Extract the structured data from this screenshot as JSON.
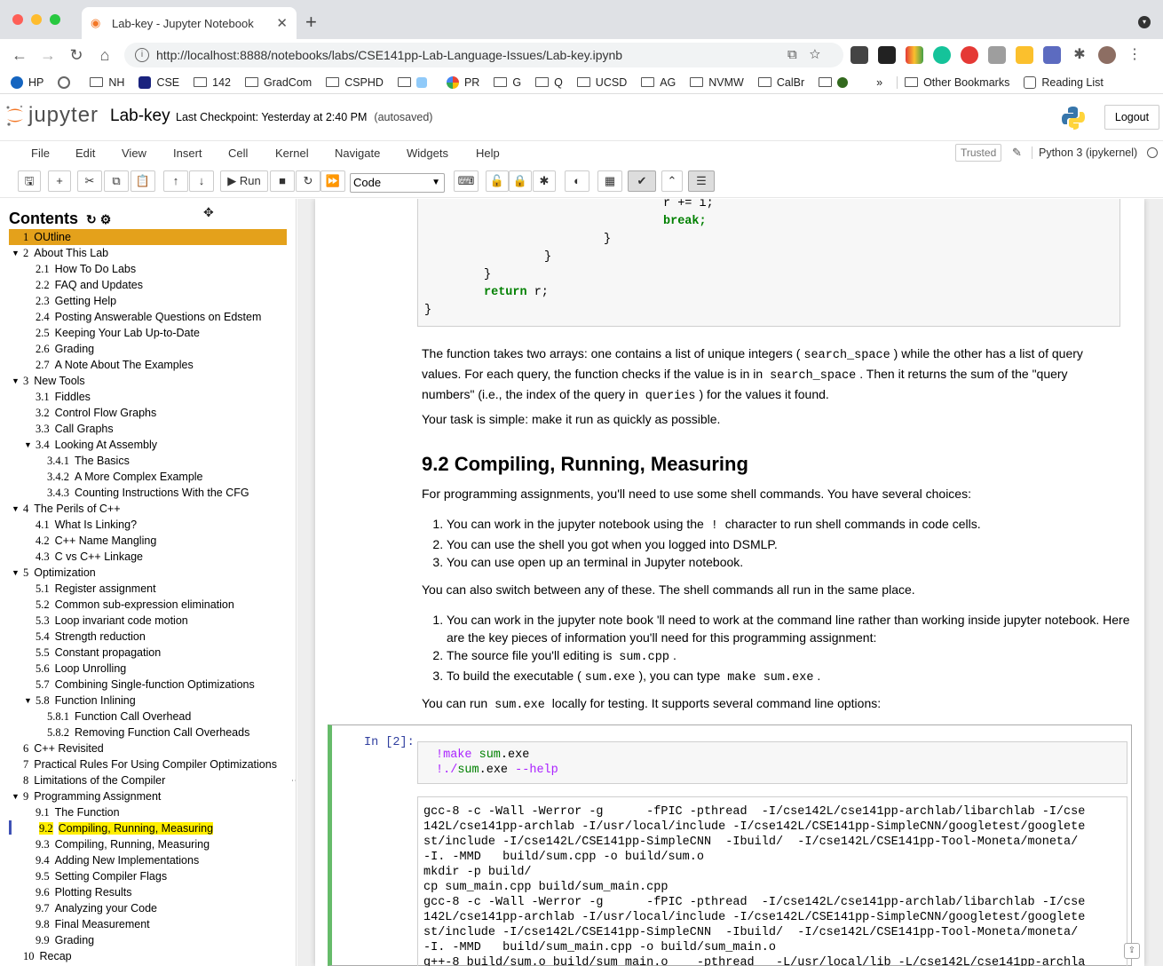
{
  "browser": {
    "tab_title": "Lab-key - Jupyter Notebook",
    "url": "http://localhost:8888/notebooks/labs/CSE141pp-Lab-Language-Issues/Lab-key.ipynb",
    "bookmarks": [
      "HP",
      "NH",
      "CSE",
      "142",
      "GradCom",
      "CSPHD",
      "PR",
      "G",
      "Q",
      "UCSD",
      "AG",
      "NVMW",
      "CalBr"
    ],
    "more": "»",
    "other_bookmarks": "Other Bookmarks",
    "reading_list": "Reading List"
  },
  "jupyter": {
    "logo_text": "jupyter",
    "notebook_name": "Lab-key",
    "checkpoint": "Last Checkpoint: Yesterday at 2:40 PM",
    "autosave": "(autosaved)",
    "logout": "Logout",
    "menu": [
      "File",
      "Edit",
      "View",
      "Insert",
      "Cell",
      "Kernel",
      "Navigate",
      "Widgets",
      "Help"
    ],
    "trusted": "Trusted",
    "kernel": "Python 3 (ipykernel)",
    "run_label": "Run",
    "cell_type": "Code"
  },
  "toc": {
    "title": "Contents",
    "items": [
      {
        "n": "1",
        "t": "OUtline",
        "lvl": 0,
        "hl": 1
      },
      {
        "n": "2",
        "t": "About This Lab",
        "lvl": 0,
        "tri": true
      },
      {
        "n": "2.1",
        "t": "How To Do Labs",
        "lvl": 1
      },
      {
        "n": "2.2",
        "t": "FAQ and Updates",
        "lvl": 1
      },
      {
        "n": "2.3",
        "t": "Getting Help",
        "lvl": 1
      },
      {
        "n": "2.4",
        "t": "Posting Answerable Questions on Edstem",
        "lvl": 1
      },
      {
        "n": "2.5",
        "t": "Keeping Your Lab Up-to-Date",
        "lvl": 1
      },
      {
        "n": "2.6",
        "t": "Grading",
        "lvl": 1
      },
      {
        "n": "2.7",
        "t": "A Note About The Examples",
        "lvl": 1
      },
      {
        "n": "3",
        "t": "New Tools",
        "lvl": 0,
        "tri": true
      },
      {
        "n": "3.1",
        "t": "Fiddles",
        "lvl": 1
      },
      {
        "n": "3.2",
        "t": "Control Flow Graphs",
        "lvl": 1
      },
      {
        "n": "3.3",
        "t": "Call Graphs",
        "lvl": 1
      },
      {
        "n": "3.4",
        "t": "Looking At Assembly",
        "lvl": 1,
        "tri": true
      },
      {
        "n": "3.4.1",
        "t": "The Basics",
        "lvl": 2
      },
      {
        "n": "3.4.2",
        "t": "A More Complex Example",
        "lvl": 2
      },
      {
        "n": "3.4.3",
        "t": "Counting Instructions With the CFG",
        "lvl": 2
      },
      {
        "n": "4",
        "t": "The Perils of C++",
        "lvl": 0,
        "tri": true
      },
      {
        "n": "4.1",
        "t": "What Is Linking?",
        "lvl": 1
      },
      {
        "n": "4.2",
        "t": "C++ Name Mangling",
        "lvl": 1
      },
      {
        "n": "4.3",
        "t": "C vs C++ Linkage",
        "lvl": 1
      },
      {
        "n": "5",
        "t": "Optimization",
        "lvl": 0,
        "tri": true
      },
      {
        "n": "5.1",
        "t": "Register assignment",
        "lvl": 1
      },
      {
        "n": "5.2",
        "t": "Common sub-expression elimination",
        "lvl": 1
      },
      {
        "n": "5.3",
        "t": "Loop invariant code motion",
        "lvl": 1
      },
      {
        "n": "5.4",
        "t": "Strength reduction",
        "lvl": 1
      },
      {
        "n": "5.5",
        "t": "Constant propagation",
        "lvl": 1
      },
      {
        "n": "5.6",
        "t": "Loop Unrolling",
        "lvl": 1
      },
      {
        "n": "5.7",
        "t": "Combining Single-function Optimizations",
        "lvl": 1
      },
      {
        "n": "5.8",
        "t": "Function Inlining",
        "lvl": 1,
        "tri": true
      },
      {
        "n": "5.8.1",
        "t": "Function Call Overhead",
        "lvl": 2
      },
      {
        "n": "5.8.2",
        "t": "Removing Function Call Overheads",
        "lvl": 2
      },
      {
        "n": "6",
        "t": "C++ Revisited",
        "lvl": 0
      },
      {
        "n": "7",
        "t": "Practical Rules For Using Compiler Optimizations",
        "lvl": 0
      },
      {
        "n": "8",
        "t": "Limitations of the Compiler",
        "lvl": 0
      },
      {
        "n": "9",
        "t": "Programming Assignment",
        "lvl": 0,
        "tri": true
      },
      {
        "n": "9.1",
        "t": "The Function",
        "lvl": 1
      },
      {
        "n": "9.2",
        "t": "Compiling, Running, Measuring",
        "lvl": 1,
        "hl": 2
      },
      {
        "n": "9.3",
        "t": "Compiling, Running, Measuring",
        "lvl": 1
      },
      {
        "n": "9.4",
        "t": "Adding New Implementations",
        "lvl": 1
      },
      {
        "n": "9.5",
        "t": "Setting Compiler Flags",
        "lvl": 1
      },
      {
        "n": "9.6",
        "t": "Plotting Results",
        "lvl": 1
      },
      {
        "n": "9.7",
        "t": "Analyzing your Code",
        "lvl": 1
      },
      {
        "n": "9.8",
        "t": "Final Measurement",
        "lvl": 1
      },
      {
        "n": "9.9",
        "t": "Grading",
        "lvl": 1
      },
      {
        "n": "10",
        "t": "Recap",
        "lvl": 0
      }
    ]
  },
  "notebook": {
    "code_tail": {
      "l1": "r += i;",
      "l2": "break;",
      "l3": "}",
      "l4": "}",
      "l5": "}",
      "l6a": "return",
      "l6b": " r;",
      "l7": "}"
    },
    "p1a": "The function takes two arrays: one contains a list of unique integers (",
    "p1c1": "search_space",
    "p1b": ") while the other has a list of query values. For each query, the function checks if the value is in in",
    "p1c2": "search_space",
    "p1d": ". Then it returns the sum of the \"query numbers\" (i.e., the index of the query in",
    "p1c3": "queries",
    "p1e": ") for the values it found.",
    "p2": "Your task is simple: make it run as quickly as possible.",
    "h2": "9.2  Compiling, Running, Measuring",
    "p3": "For programming assignments, you'll need to use some shell commands. You have several choices:",
    "list1": {
      "i1a": "You can work in the jupyter notebook using the",
      "i1c": "!",
      "i1b": "character to run shell commands in code cells.",
      "i2": "You can use the shell you got when you logged into DSMLP.",
      "i3": "You can use open up an terminal in Jupyter notebook."
    },
    "p4": "You can also switch between any of these. The shell commands all run in the same place.",
    "list2": {
      "i1": "You can work in the jupyter note book 'll need to work at the command line rather than working inside jupyter notebook. Here are the key pieces of information you'll need for this programming assignment:",
      "i2a": "The source file you'll editing is",
      "i2c": "sum.cpp",
      "i2b": ".",
      "i3a": "To build the executable (",
      "i3c1": "sum.exe",
      "i3b": "), you can type",
      "i3c2": "make sum.exe",
      "i3d": "."
    },
    "p5a": "You can run",
    "p5c": "sum.exe",
    "p5b": "locally for testing. It supports several command line options:",
    "cell_prompt": "In [2]:",
    "input": {
      "l1a": "!make ",
      "l1b": "sum",
      "l1c": ".exe",
      "l2a": "!./",
      "l2b": "sum",
      "l2c": ".exe ",
      "l2d": "--help"
    },
    "output": "gcc-8 -c -Wall -Werror -g      -fPIC -pthread  -I/cse142L/cse141pp-archlab/libarchlab -I/cse\n142L/cse141pp-archlab -I/usr/local/include -I/cse142L/CSE141pp-SimpleCNN/googletest/googlete\nst/include -I/cse142L/CSE141pp-SimpleCNN  -Ibuild/  -I/cse142L/CSE141pp-Tool-Moneta/moneta/\n-I. -MMD   build/sum.cpp -o build/sum.o\nmkdir -p build/\ncp sum_main.cpp build/sum_main.cpp\ngcc-8 -c -Wall -Werror -g      -fPIC -pthread  -I/cse142L/cse141pp-archlab/libarchlab -I/cse\n142L/cse141pp-archlab -I/usr/local/include -I/cse142L/CSE141pp-SimpleCNN/googletest/googlete\nst/include -I/cse142L/CSE141pp-SimpleCNN  -Ibuild/  -I/cse142L/CSE141pp-Tool-Moneta/moneta/\n-I. -MMD   build/sum_main.cpp -o build/sum_main.o\ng++-8 build/sum.o build/sum_main.o    -pthread   -L/usr/local/lib -L/cse142L/cse141pp-archla"
  },
  "colors": {
    "toc_highlight": "#e4a11b",
    "toc_current": "#ffee00",
    "cell_selected": "#66bb6a",
    "prompt": "#303f9f",
    "keyword": "#008000"
  }
}
